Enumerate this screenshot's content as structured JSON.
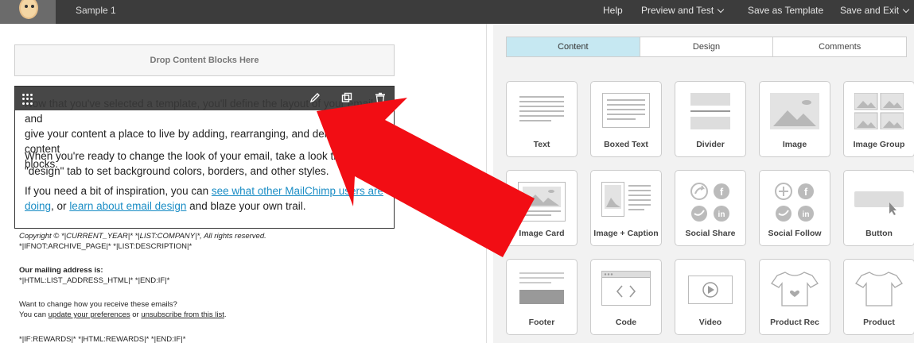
{
  "topbar": {
    "doc_title": "Sample 1",
    "nav": {
      "help": "Help",
      "preview": "Preview and Test",
      "save_template": "Save as Template",
      "save_exit": "Save and Exit"
    }
  },
  "editor": {
    "dropzone_label": "Drop Content Blocks Here",
    "paragraph1_a": "Now that you've selected a template, you'll define the layout of your email and",
    "paragraph1_b": "give your content a place to live by adding, rearranging, and deleting content",
    "paragraph1_c": "blocks.",
    "paragraph2_a": "When you're ready to change the look of your email, take a look through the",
    "paragraph2_b": "\"design\" tab to set background colors, borders, and other styles.",
    "paragraph3_prefix": "If you need a bit of inspiration, you can ",
    "paragraph3_link1": "see what other MailChimp users are doing",
    "paragraph3_mid": ", or ",
    "paragraph3_link2": "learn about email design",
    "paragraph3_suffix": " and blaze your own trail."
  },
  "footer": {
    "copyright": "Copyright © *|CURRENT_YEAR|* *|LIST:COMPANY|*, All rights reserved.",
    "archive": "*|IFNOT:ARCHIVE_PAGE|* *|LIST:DESCRIPTION|*",
    "mailing_heading": "Our mailing address is:",
    "mailing_value": "*|HTML:LIST_ADDRESS_HTML|* *|END:IF|*",
    "change_question": "Want to change how you receive these emails?",
    "change_prefix": "You can ",
    "update_link": "update your preferences",
    "or": " or ",
    "unsubscribe_link": "unsubscribe from this list",
    "change_suffix": ".",
    "rewards": "*|IF:REWARDS|* *|HTML:REWARDS|* *|END:IF|*"
  },
  "panel": {
    "tabs": [
      "Content",
      "Design",
      "Comments"
    ],
    "blocks": [
      "Text",
      "Boxed Text",
      "Divider",
      "Image",
      "Image Group",
      "Image Card",
      "Image + Caption",
      "Social Share",
      "Social Follow",
      "Button",
      "Footer",
      "Code",
      "Video",
      "Product Rec",
      "Product"
    ]
  },
  "colors": {
    "topbar": "#3c3c3c",
    "active_tab": "#c6e8f2",
    "link": "#1a8dc5",
    "arrow": "#f20d14"
  }
}
